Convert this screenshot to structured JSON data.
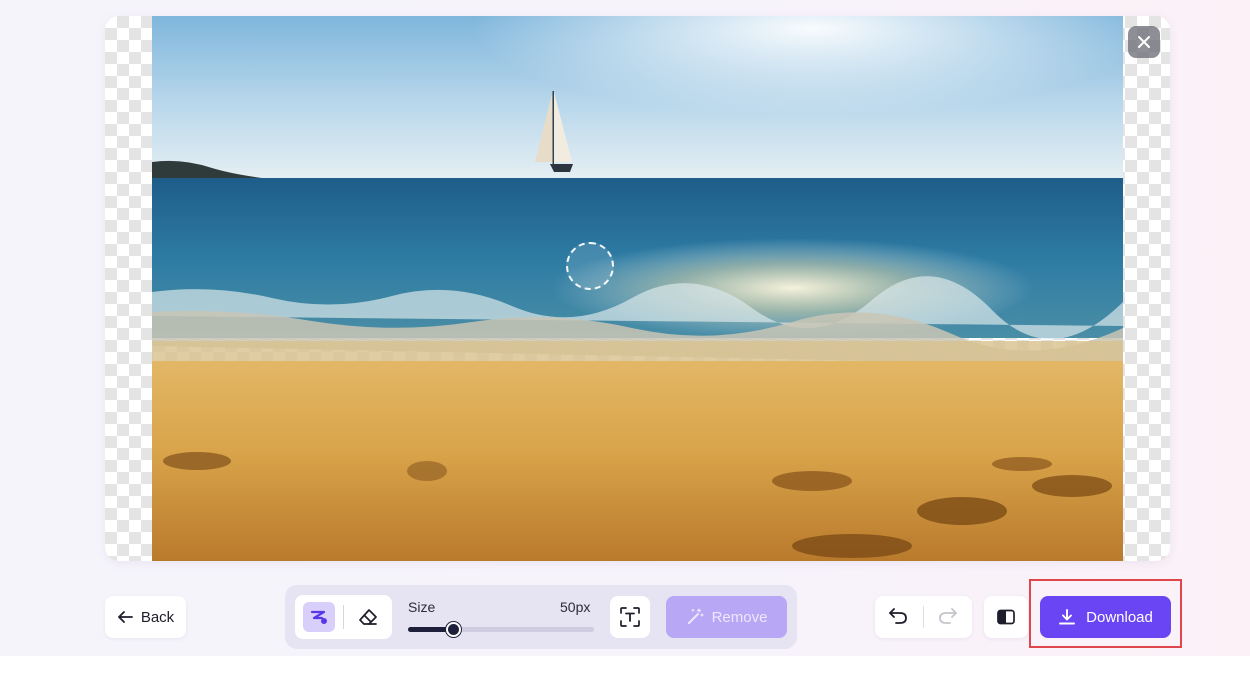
{
  "canvas": {
    "close_icon": "close-icon",
    "photo_icon": "beach-sailboat-photo"
  },
  "toolbar": {
    "back_label": "Back",
    "size_label": "Size",
    "size_value": "50px",
    "size_fraction": 0.24,
    "remove_label": "Remove",
    "download_label": "Download"
  },
  "colors": {
    "accent": "#6a45f3",
    "accent_disabled": "#b7a7f5",
    "highlight": "#e0474c"
  }
}
